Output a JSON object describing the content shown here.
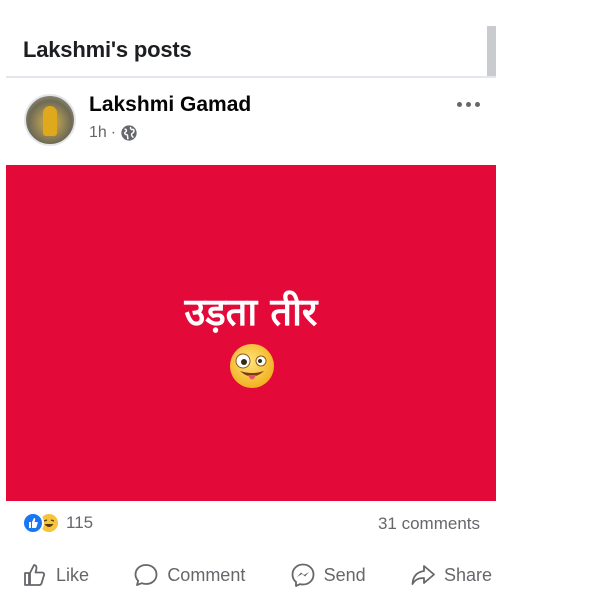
{
  "header": {
    "title": "Lakshmi's posts"
  },
  "post": {
    "author": "Lakshmi Gamad",
    "time": "1h",
    "separator": "·",
    "privacy_icon": "globe-icon",
    "more_icon": "more-options-icon",
    "image": {
      "background_color": "#e30a3a",
      "text": "उड़ता तीर",
      "emoji_icon": "zany-face-emoji"
    },
    "reactions": {
      "icons": [
        "like-reaction-icon",
        "haha-reaction-icon"
      ],
      "count": "115"
    },
    "comments": "31 comments"
  },
  "actions": {
    "like": "Like",
    "comment": "Comment",
    "send": "Send",
    "share": "Share"
  },
  "colors": {
    "accent": "#1877f2",
    "text_secondary": "#65676b",
    "post_background": "#e30a3a"
  }
}
